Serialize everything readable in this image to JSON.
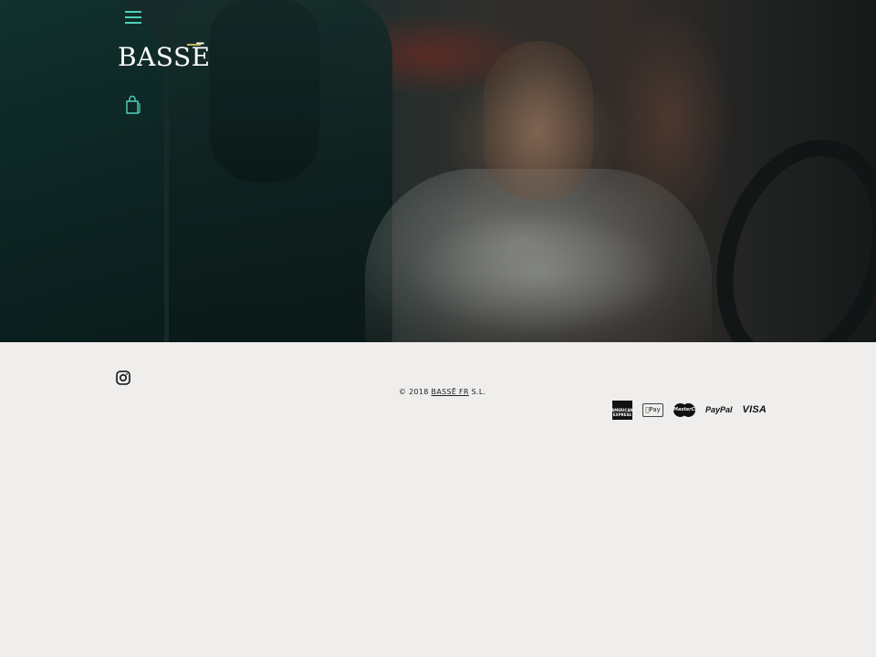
{
  "header": {
    "logo_text": "BASSĒ",
    "menu_icon": "hamburger-menu-icon",
    "cart_icon": "shopping-bag-icon",
    "accent_color": "#4fd1b8"
  },
  "hero": {
    "image_subject": "hero-photo"
  },
  "footer": {
    "social_icon": "instagram-icon",
    "copyright_prefix": "© 2018",
    "copyright_link": "BASSĒ FR",
    "copyright_suffix": "S.L.",
    "payment_methods": [
      {
        "name": "amex",
        "label": "AMERICAN EXPRESS"
      },
      {
        "name": "apple-pay",
        "label": "Pay"
      },
      {
        "name": "mastercard",
        "label": "MasterCard"
      },
      {
        "name": "paypal",
        "label": "PayPal"
      },
      {
        "name": "visa",
        "label": "VISA"
      }
    ]
  }
}
